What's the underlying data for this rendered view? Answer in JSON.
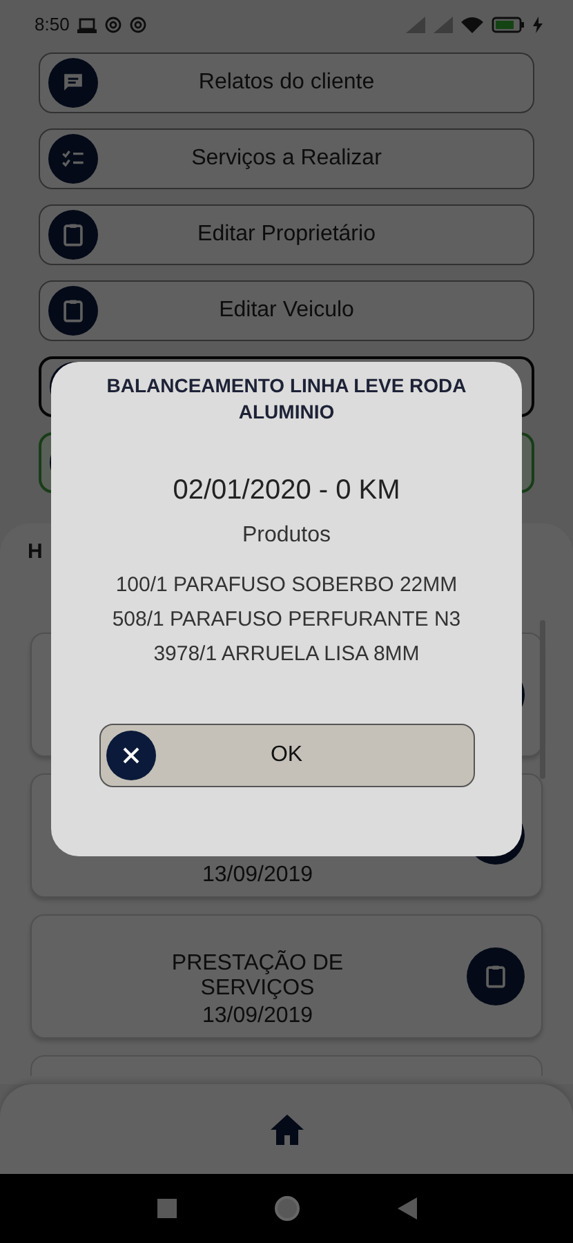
{
  "status_bar": {
    "time": "8:50"
  },
  "menu": [
    {
      "kind": "chat",
      "label": "Relatos do cliente"
    },
    {
      "kind": "checklist",
      "label": "Serviços a Realizar"
    },
    {
      "kind": "clipboard",
      "label": "Editar Proprietário"
    },
    {
      "kind": "clipboard",
      "label": "Editar Veiculo"
    },
    {
      "kind": "outlined"
    },
    {
      "kind": "success"
    }
  ],
  "history": {
    "heading": "H",
    "cards": [
      {
        "kind": "covered"
      },
      {
        "kind": "covered",
        "date": "13/09/2019"
      },
      {
        "kind": "service",
        "title": "PRESTAÇÃO DE SERVIÇOS",
        "date": "13/09/2019"
      },
      {
        "kind": "partial"
      }
    ]
  },
  "dialog": {
    "title": "BALANCEAMENTO LINHA LEVE RODA ALUMINIO",
    "date_km": "02/01/2020 - 0 KM",
    "section": "Produtos",
    "products": [
      "100/1 PARAFUSO SOBERBO 22MM",
      "508/1 PARAFUSO PERFURANTE N3",
      "3978/1 ARRUELA LISA 8MM"
    ],
    "button": "OK"
  }
}
